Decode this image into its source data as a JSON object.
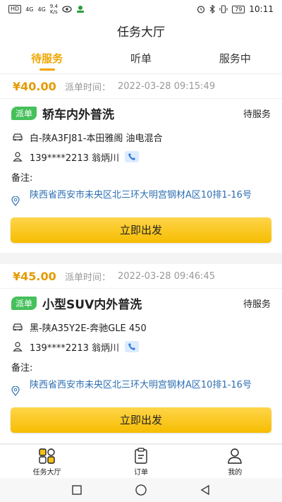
{
  "statusbar": {
    "hd": "HD",
    "sig1": "4G",
    "sig2": "4G",
    "speed_value": "9.4",
    "speed_unit": "K/s",
    "battery": "79",
    "time": "10:11"
  },
  "header": {
    "title": "任务大厅"
  },
  "tabs": [
    {
      "label": "待服务",
      "active": true
    },
    {
      "label": "听单",
      "active": false
    },
    {
      "label": "服务中",
      "active": false
    }
  ],
  "orders": [
    {
      "price": "¥40.00",
      "time_label": "派单时间：",
      "time": "2022-03-28 09:15:49",
      "tag": "派单",
      "service": "轿车内外普洗",
      "status": "待服务",
      "vehicle": "白-陕A3FJ81-本田雅阁 油电混合",
      "contact": "139****2213 翁炳川",
      "note_label": "备注:",
      "address": "陕西省西安市未央区北三环大明宫钢材A区10排1-16号",
      "button": "立即出发"
    },
    {
      "price": "¥45.00",
      "time_label": "派单时间：",
      "time": "2022-03-28 09:46:45",
      "tag": "派单",
      "service": "小型SUV内外普洗",
      "status": "待服务",
      "vehicle": "黑-陕A35Y2E-奔驰GLE 450",
      "contact": "139****2213 翁炳川",
      "note_label": "备注:",
      "address": "陕西省西安市未央区北三环大明宫钢材A区10排1-16号",
      "button": "立即出发"
    }
  ],
  "bottom_nav": [
    {
      "label": "任务大厅",
      "icon": "grid-icon"
    },
    {
      "label": "订单",
      "icon": "clipboard-icon"
    },
    {
      "label": "我的",
      "icon": "person-icon"
    }
  ],
  "colors": {
    "accent": "#f0a600",
    "tag_green": "#45c05a",
    "address_blue": "#2d6fb3"
  }
}
